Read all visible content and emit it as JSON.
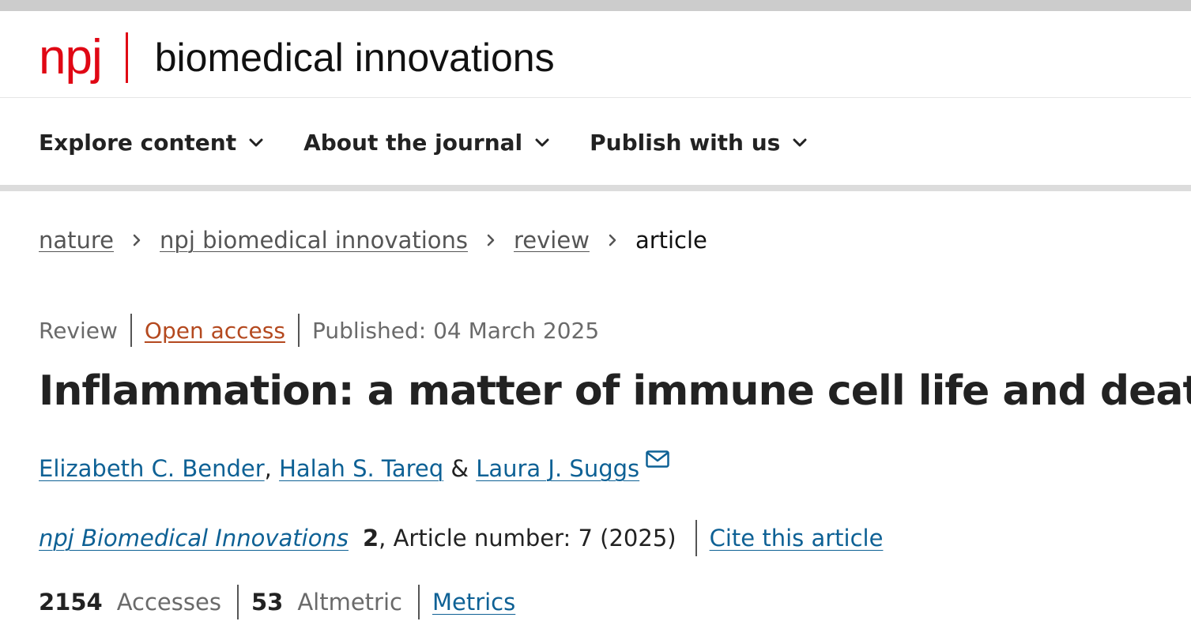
{
  "header": {
    "logo_npj": "npj",
    "logo_name": "biomedical innovations",
    "brand_color": "#e00714"
  },
  "nav": {
    "items": [
      {
        "label": "Explore content"
      },
      {
        "label": "About the journal"
      },
      {
        "label": "Publish with us"
      }
    ]
  },
  "breadcrumb": {
    "items": [
      {
        "label": "nature"
      },
      {
        "label": "npj biomedical innovations"
      },
      {
        "label": "review"
      }
    ],
    "current": "article"
  },
  "article": {
    "type": "Review",
    "access": "Open access",
    "published": "Published: 04 March 2025",
    "title": "Inflammation: a matter of immune cell life and death",
    "authors": [
      {
        "name": "Elizabeth C. Bender"
      },
      {
        "name": "Halah S. Tareq"
      },
      {
        "name": "Laura J. Suggs"
      }
    ],
    "author_sep_1": ", ",
    "author_sep_2": " & ",
    "journal": "npj Biomedical Innovations",
    "volume": "2",
    "article_number": ", Article number: 7 (2025)",
    "cite_label": "Cite this article"
  },
  "metrics": {
    "accesses_value": "2154",
    "accesses_label": "Accesses",
    "altmetric_value": "53",
    "altmetric_label": "Altmetric",
    "metrics_link": "Metrics"
  },
  "colors": {
    "link": "#0e6195",
    "open_access": "#b4491f"
  },
  "icons": {
    "nav_chevron": "chevron-down-icon",
    "breadcrumb_separator": "chevron-right-icon",
    "corresponding_author": "envelope-icon"
  }
}
